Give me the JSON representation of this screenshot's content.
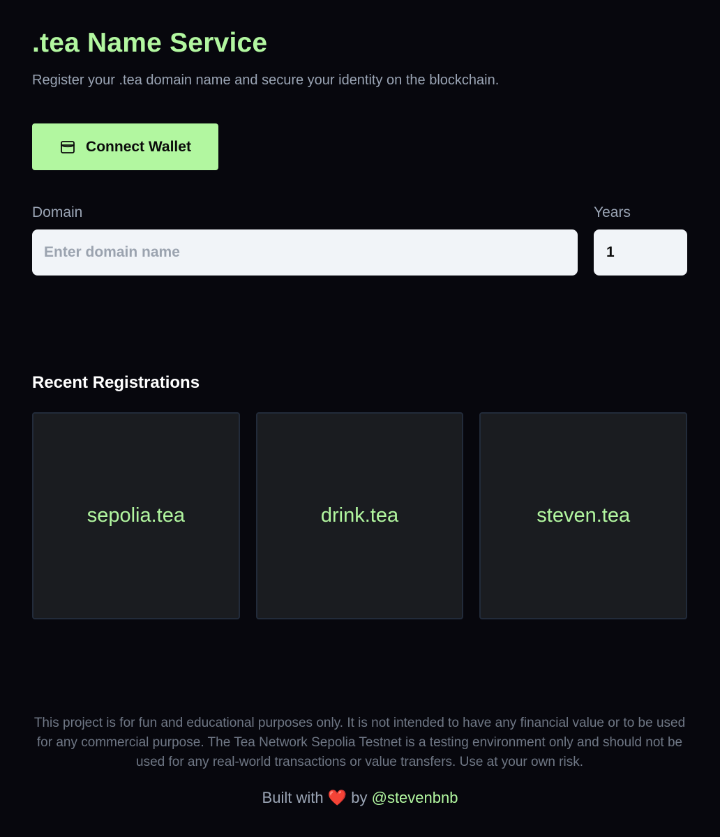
{
  "header": {
    "title": ".tea Name Service",
    "subtitle": "Register your .tea domain name and secure your identity on the blockchain."
  },
  "wallet": {
    "button_label": "Connect Wallet",
    "icon": "wallet-icon"
  },
  "form": {
    "domain_label": "Domain",
    "domain_placeholder": "Enter domain name",
    "domain_value": "",
    "years_label": "Years",
    "years_value": "1"
  },
  "recent": {
    "title": "Recent Registrations",
    "items": [
      {
        "name": "sepolia.tea"
      },
      {
        "name": "drink.tea"
      },
      {
        "name": "steven.tea"
      }
    ]
  },
  "footer": {
    "disclaimer": "This project is for fun and educational purposes only. It is not intended to have any financial value or to be used for any commercial purpose. The Tea Network Sepolia Testnet is a testing environment only and should not be used for any real-world transactions or value transfers. Use at your own risk.",
    "built_prefix": "Built with",
    "heart": "❤️",
    "built_by": "by",
    "author": "@stevenbnb"
  },
  "colors": {
    "background": "#07070d",
    "accent": "#b2f7a0",
    "muted_text": "#9aa4b4",
    "card_bg": "#1a1c20",
    "input_bg": "#f1f4f8"
  }
}
